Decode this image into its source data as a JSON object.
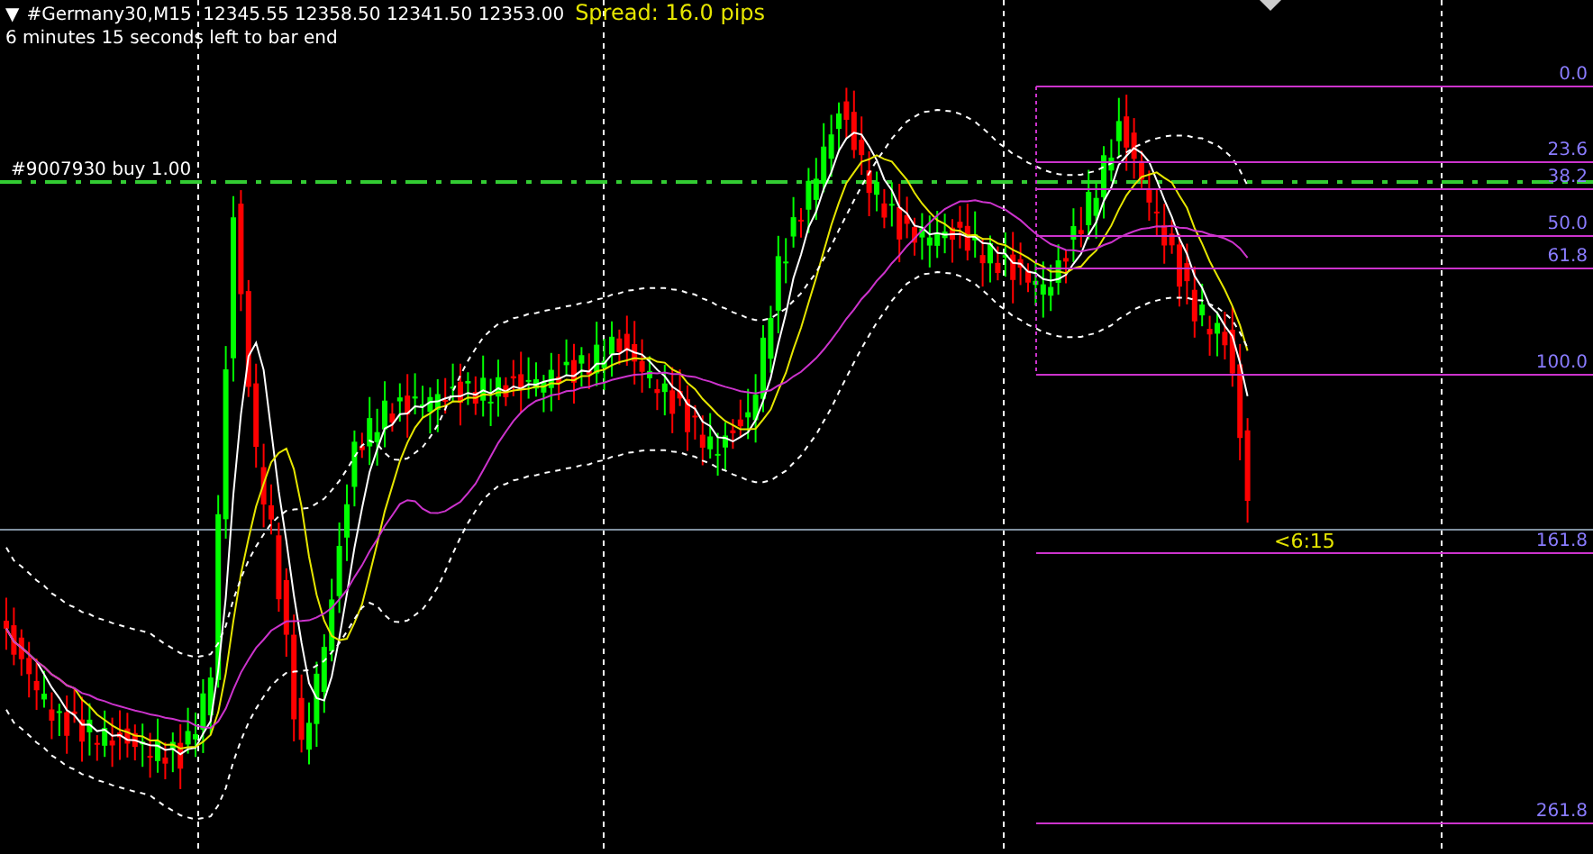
{
  "header": {
    "menu_glyph": "▼",
    "symbol_quote": "#Germany30,M15  12345.55 12358.50 12341.50 12353.00",
    "spread": "Spread: 16.0 pips",
    "timer_note": "6 minutes 15 seconds left to bar end"
  },
  "order_line": {
    "label": "#9007930 buy 1.00"
  },
  "countdown": "<6:15",
  "fibonacci_levels": [
    {
      "label": "0.0"
    },
    {
      "label": "23.6"
    },
    {
      "label": "38.2"
    },
    {
      "label": "50.0"
    },
    {
      "label": "61.8"
    },
    {
      "label": "100.0"
    },
    {
      "label": "161.8"
    },
    {
      "label": "261.8"
    }
  ]
}
